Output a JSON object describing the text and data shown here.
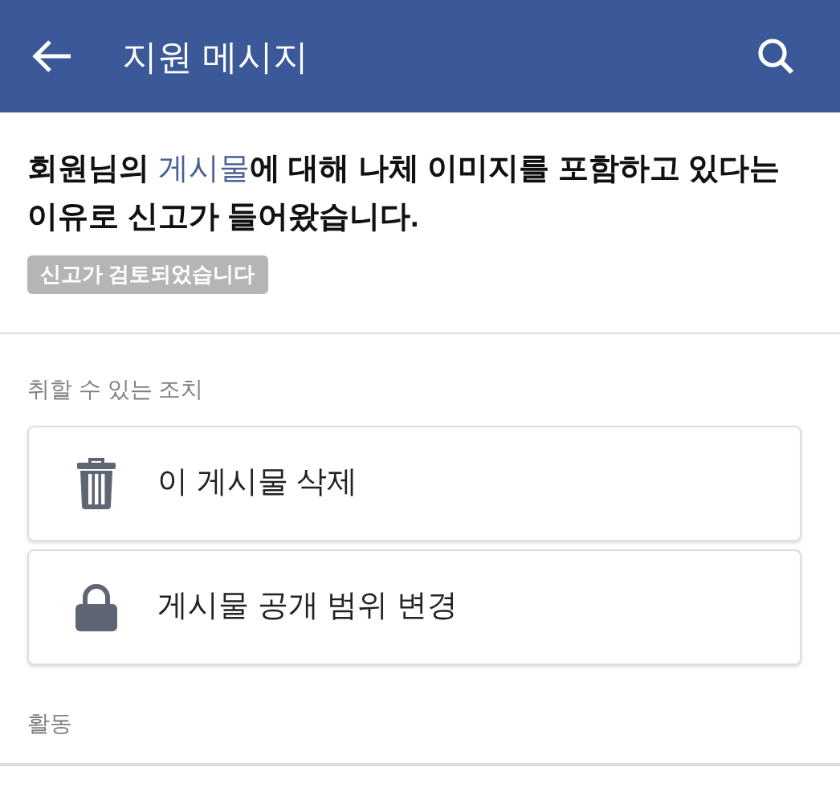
{
  "header": {
    "title": "지원 메시지"
  },
  "message": [
    {
      "kind": "text",
      "text": "회원님의 "
    },
    {
      "kind": "link",
      "text": "게시물"
    },
    {
      "kind": "text",
      "text": "에 대해 나체 이미지를 포함하고 있다는 이유로 신고가 들어왔습니다."
    }
  ],
  "status_badge": "신고가 검토되었습니다",
  "actions_label": "취할 수 있는 조치",
  "actions": [
    {
      "kind": "delete",
      "label": "이 게시물 삭제"
    },
    {
      "kind": "privacy",
      "label": "게시물 공개 범위 변경"
    }
  ],
  "activity_label": "활동"
}
